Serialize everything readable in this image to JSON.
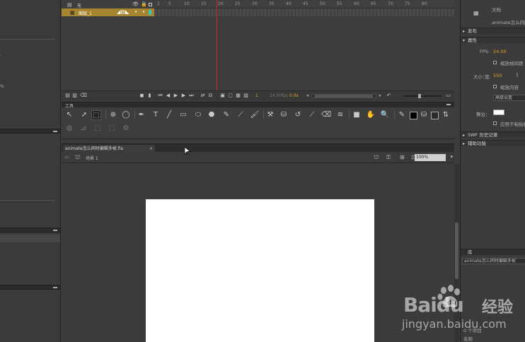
{
  "timeline": {
    "layers": [
      {
        "name": "无"
      },
      {
        "name": "图层_1"
      }
    ],
    "frame_ticks": [
      "1",
      "5",
      "10",
      "15",
      "20",
      "25",
      "30",
      "35",
      "40",
      "45",
      "50",
      "55",
      "60",
      "65",
      "70",
      "75",
      "80"
    ],
    "current_frame": "1",
    "frame_rate_readout": "24.00fps",
    "elapsed": "0.0s"
  },
  "tools_panel": {
    "title": "工具"
  },
  "document": {
    "tab_label": "animate怎么同时编辑多帧.fla",
    "breadcrumb": "场景 1",
    "zoom": "100%",
    "stage_color": "#ffffff"
  },
  "properties": {
    "doc_label": "文档",
    "doc_name": "animate怎么同时编",
    "sections": {
      "publish": "发布",
      "properties": "属性",
      "swf_history": "SWF 历史记录",
      "accessibility": "辅助功能"
    },
    "fps_label": "FPS:",
    "fps_value": "24.00",
    "scale_content_label": "缩放帧间距",
    "size_label": "大小：",
    "width_label": "宽:",
    "width_value": "550",
    "scale_check_label": "缩放内容",
    "advanced_button": "高级设置",
    "stage_label": "舞台：",
    "apply_check_label": "应用于粘贴板"
  },
  "library": {
    "tab": "库",
    "doc_select": "animate怎么同时编辑多帧",
    "name_col": "名称",
    "items_label": "0 个项目"
  },
  "watermark": {
    "brand": "Baidu",
    "jingyan": "经验",
    "url": "jingyan.baidu.com"
  },
  "colors": {
    "accent_layer": "#a5852f",
    "playhead": "#c6282b",
    "fps_orange": "#e0a02a"
  }
}
